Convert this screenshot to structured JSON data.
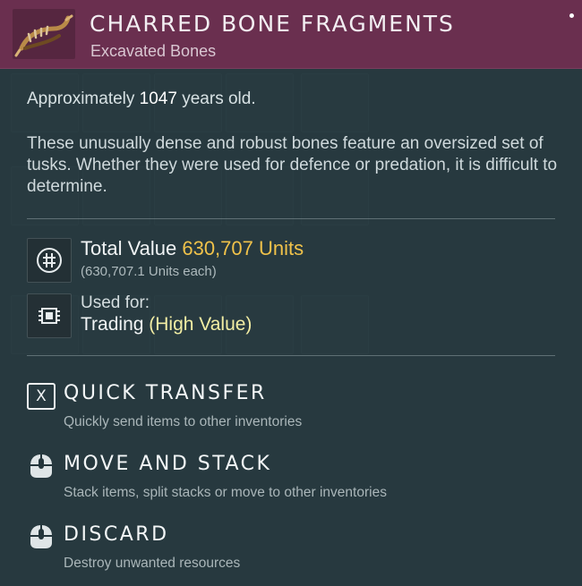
{
  "item": {
    "title": "CHARRED BONE FRAGMENTS",
    "category": "Excavated Bones",
    "icon": "jawbone-icon",
    "header_color": "#6a2f4f"
  },
  "age": {
    "prefix": "Approximately ",
    "years": "1047",
    "suffix": " years old."
  },
  "description": "These unusually dense and robust bones feature an oversized set of tusks. Whether they were used for defence or predation, it is difficult to determine.",
  "value": {
    "label": "Total Value ",
    "amount": "630,707 Units",
    "each": "(630,707.1 Units each)",
    "icon": "units-icon",
    "amount_color": "#f0c24a"
  },
  "usage": {
    "label": "Used for:",
    "value": "Trading ",
    "highlight": "(High Value)",
    "icon": "chip-icon"
  },
  "actions": [
    {
      "label": "QUICK TRANSFER",
      "desc": "Quickly send items to other inventories",
      "icon": "x-key-icon",
      "key": "X"
    },
    {
      "label": "MOVE AND STACK",
      "desc": "Stack items, split stacks or move to other inventories",
      "icon": "mouse-left-icon"
    },
    {
      "label": "DISCARD",
      "desc": "Destroy unwanted resources",
      "icon": "mouse-hold-icon"
    }
  ]
}
